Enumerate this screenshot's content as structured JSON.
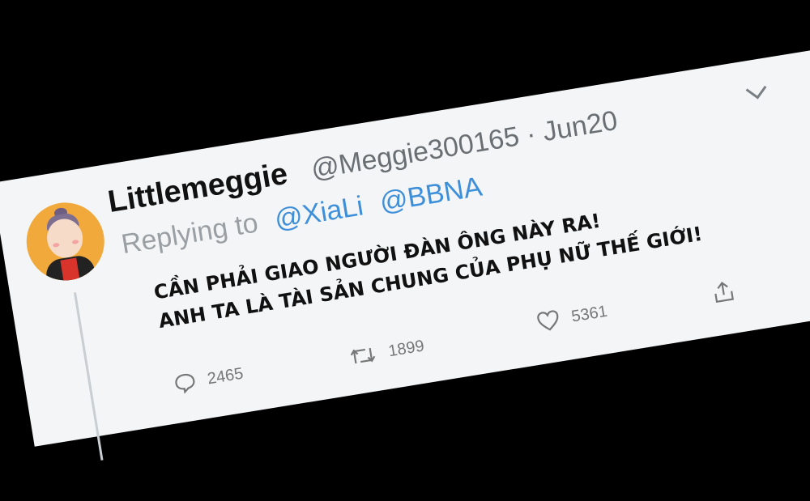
{
  "tweet": {
    "display_name": "Littlemeggie",
    "handle_and_date": "@Meggie300165 · Jun20",
    "replying_label": "Replying to",
    "mentions": [
      "@XiaLi",
      "@BBNA"
    ],
    "caption_lines": [
      "CẦN PHẢI GIAO NGƯỜI ĐÀN ÔNG NÀY RA!",
      "ANH TA LÀ TÀI SẢN CHUNG CỦA PHỤ NỮ THẾ GIỚI!"
    ],
    "stats": {
      "replies": "2465",
      "retweets": "1899",
      "likes": "5361"
    }
  },
  "colors": {
    "mention": "#3e8fd9",
    "background": "#000000",
    "card": "#f3f5f7"
  }
}
